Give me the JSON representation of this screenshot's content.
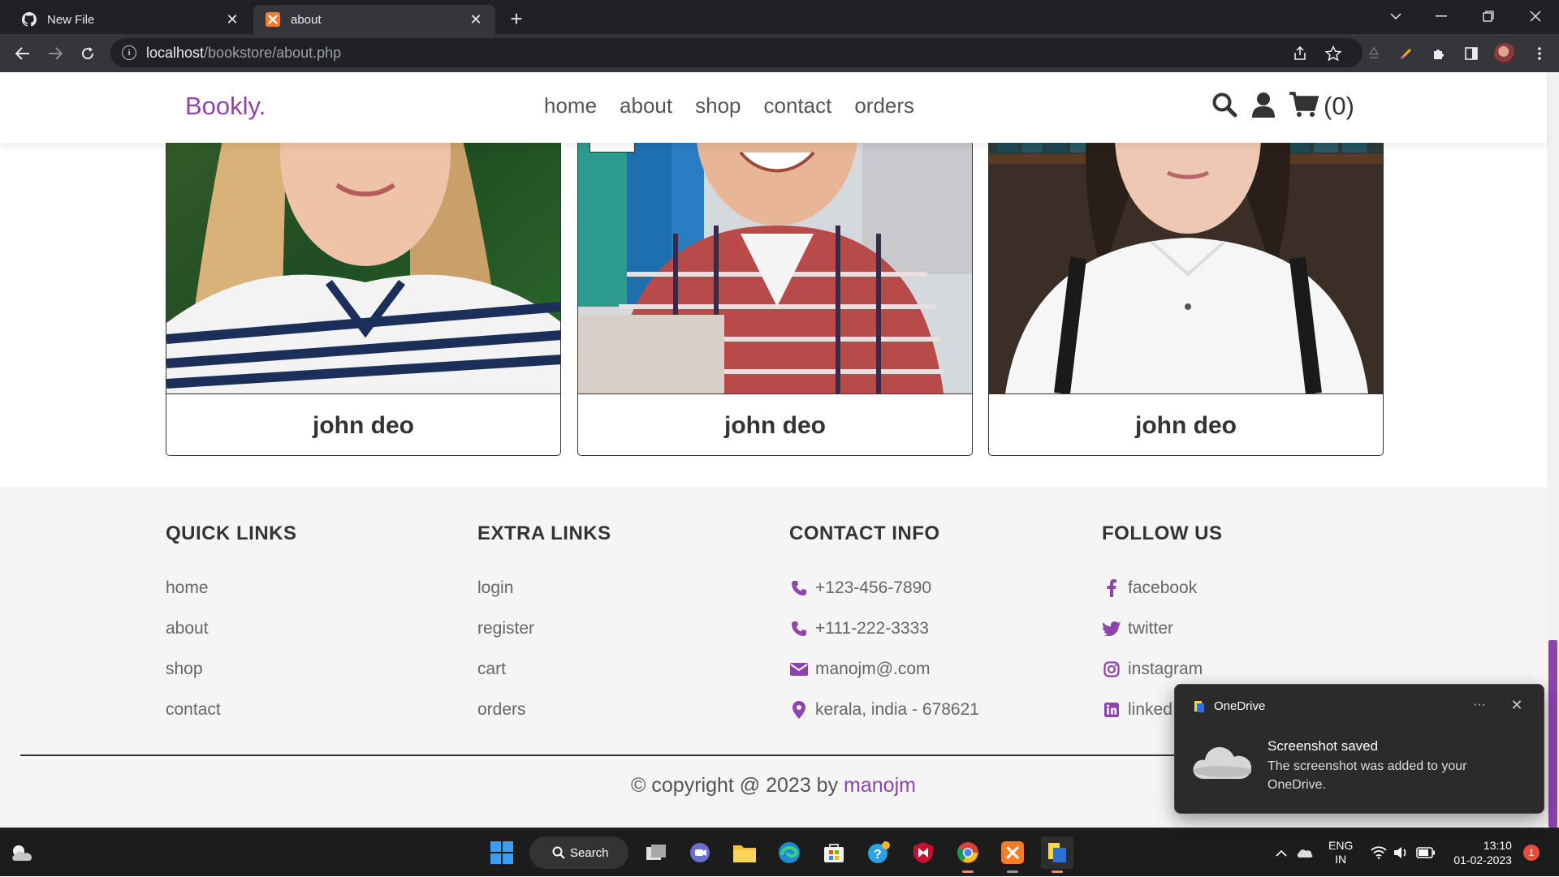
{
  "browser": {
    "tabs": [
      {
        "label": "New File",
        "icon": "github-icon"
      },
      {
        "label": "about",
        "icon": "xampp-icon"
      }
    ],
    "url_host": "localhost",
    "url_path": "/bookstore/about.php"
  },
  "site": {
    "logo": "Bookly.",
    "nav": [
      "home",
      "about",
      "shop",
      "contact",
      "orders"
    ],
    "cart_count": "(0)",
    "accent": "#8e44ad"
  },
  "team": [
    {
      "name": "john deo"
    },
    {
      "name": "john deo"
    },
    {
      "name": "john deo"
    }
  ],
  "footer": {
    "quick_links": {
      "title": "QUICK LINKS",
      "items": [
        "home",
        "about",
        "shop",
        "contact"
      ]
    },
    "extra_links": {
      "title": "EXTRA LINKS",
      "items": [
        "login",
        "register",
        "cart",
        "orders"
      ]
    },
    "contact_info": {
      "title": "CONTACT INFO",
      "items": [
        {
          "icon": "phone-icon",
          "text": "+123-456-7890"
        },
        {
          "icon": "phone-icon",
          "text": "+111-222-3333"
        },
        {
          "icon": "envelope-icon",
          "text": "manojm@.com"
        },
        {
          "icon": "map-marker-icon",
          "text": "kerala, india - 678621"
        }
      ]
    },
    "follow_us": {
      "title": "FOLLOW US",
      "items": [
        {
          "icon": "facebook-icon",
          "text": "facebook"
        },
        {
          "icon": "twitter-icon",
          "text": "twitter"
        },
        {
          "icon": "instagram-icon",
          "text": "instagram"
        },
        {
          "icon": "linkedin-icon",
          "text": "linked"
        }
      ]
    },
    "credit_prefix": "© copyright @ 2023 by",
    "credit_brand": "manojm"
  },
  "toast": {
    "app": "OneDrive",
    "title": "Screenshot saved",
    "body": "The screenshot was added to your OneDrive."
  },
  "taskbar": {
    "search": "Search",
    "lang1": "ENG",
    "lang2": "IN",
    "time": "13:10",
    "date": "01-02-2023",
    "badge": "1"
  }
}
